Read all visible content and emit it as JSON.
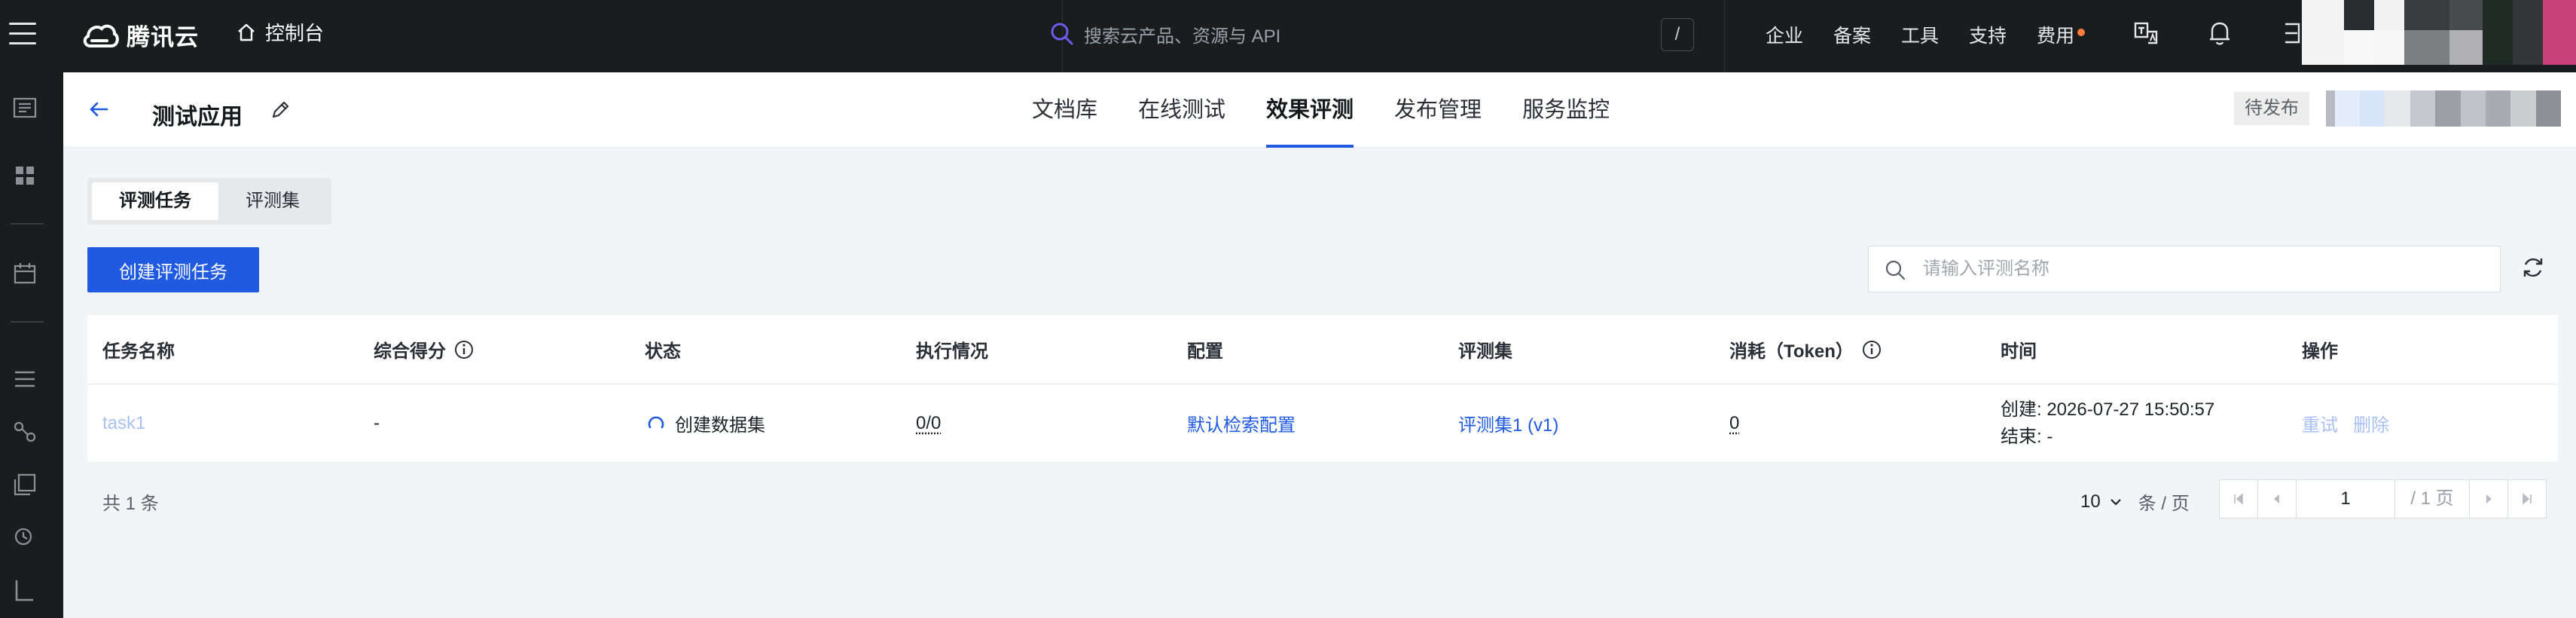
{
  "topbar": {
    "brand": "腾讯云",
    "console": "控制台",
    "search_placeholder": "搜索云产品、资源与 API",
    "search_shortcut": "/",
    "links": [
      "企业",
      "备案",
      "工具",
      "支持",
      "费用"
    ],
    "icons": [
      "translate-icon",
      "bell-icon",
      "cart-icon"
    ]
  },
  "app": {
    "title": "测试应用",
    "tabs": [
      "文档库",
      "在线测试",
      "效果评测",
      "发布管理",
      "服务监控"
    ],
    "active_tab": "效果评测",
    "status": "待发布"
  },
  "segment": {
    "items": [
      "评测任务",
      "评测集"
    ],
    "active": "评测任务"
  },
  "toolbar": {
    "create_label": "创建评测任务",
    "search_placeholder": "请输入评测名称"
  },
  "table": {
    "headers": [
      "任务名称",
      "综合得分",
      "状态",
      "执行情况",
      "配置",
      "评测集",
      "消耗（Token）",
      "时间",
      "操作"
    ],
    "rows": [
      {
        "name": "task1",
        "score": "-",
        "status": "创建数据集",
        "progress": "0/0",
        "config": "默认检索配置",
        "dataset": "评测集1 (v1)",
        "tokens": "0",
        "created": "创建: 2026-07-27 15:50:57",
        "ended": "结束: -",
        "actions": [
          "重试",
          "删除"
        ]
      }
    ]
  },
  "pagination": {
    "total": "共 1 条",
    "page_size": "10",
    "page_size_unit": "条 / 页",
    "current_page": "1",
    "total_pages": "/ 1 页"
  },
  "colors": {
    "primary": "#1f5ae0",
    "topbar": "#1b1c1e",
    "fee_dot": "#ff7d3b"
  }
}
